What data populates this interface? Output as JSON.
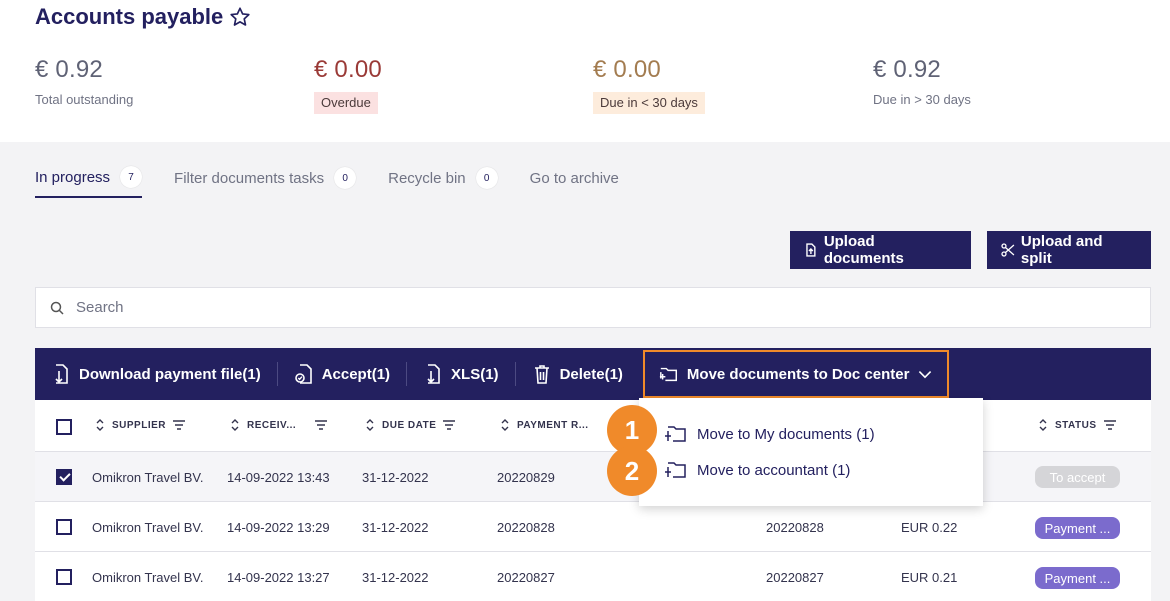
{
  "page": {
    "title": "Accounts payable"
  },
  "summary": [
    {
      "amount": "€ 0.92",
      "label": "Total outstanding"
    },
    {
      "amount": "€ 0.00",
      "label": "Overdue"
    },
    {
      "amount": "€ 0.00",
      "label": "Due in < 30 days"
    },
    {
      "amount": "€ 0.92",
      "label": "Due in > 30 days"
    }
  ],
  "tabs": [
    {
      "label": "In progress",
      "count": "7"
    },
    {
      "label": "Filter documents tasks",
      "count": "0"
    },
    {
      "label": "Recycle bin",
      "count": "0"
    },
    {
      "label": "Go to archive"
    }
  ],
  "actions": {
    "upload": "Upload documents",
    "upload_split": "Upload and split"
  },
  "search": {
    "placeholder": "Search"
  },
  "toolbar": {
    "download": "Download payment file(1)",
    "accept": "Accept(1)",
    "xls": "XLS(1)",
    "delete": "Delete(1)",
    "move": "Move documents to Doc center"
  },
  "dropdown": {
    "items": [
      {
        "label": "Move to My documents (1)"
      },
      {
        "label": "Move to accountant (1)"
      }
    ]
  },
  "markers": [
    "1",
    "2"
  ],
  "table": {
    "headers": [
      "SUPPLIER",
      "RECEIV...",
      "DUE DATE",
      "PAYMENT R...",
      "STATUS"
    ],
    "rows": [
      {
        "supplier": "Omikron Travel BV.",
        "received": "14-09-2022 13:43",
        "due": "31-12-2022",
        "payment_ref": "20220829",
        "ref2": "",
        "amount": "",
        "status": "To accept",
        "checked": true
      },
      {
        "supplier": "Omikron Travel BV.",
        "received": "14-09-2022 13:29",
        "due": "31-12-2022",
        "payment_ref": "20220828",
        "ref2": "20220828",
        "amount": "EUR 0.22",
        "status": "Payment ...",
        "checked": false
      },
      {
        "supplier": "Omikron Travel BV.",
        "received": "14-09-2022 13:27",
        "due": "31-12-2022",
        "payment_ref": "20220827",
        "ref2": "20220827",
        "amount": "EUR 0.21",
        "status": "Payment ...",
        "checked": false
      }
    ]
  },
  "colors": {
    "primary": "#23205f",
    "accent": "#f08a2a",
    "status_purple": "#7b6bcd",
    "status_gray": "#d5d5d8"
  }
}
